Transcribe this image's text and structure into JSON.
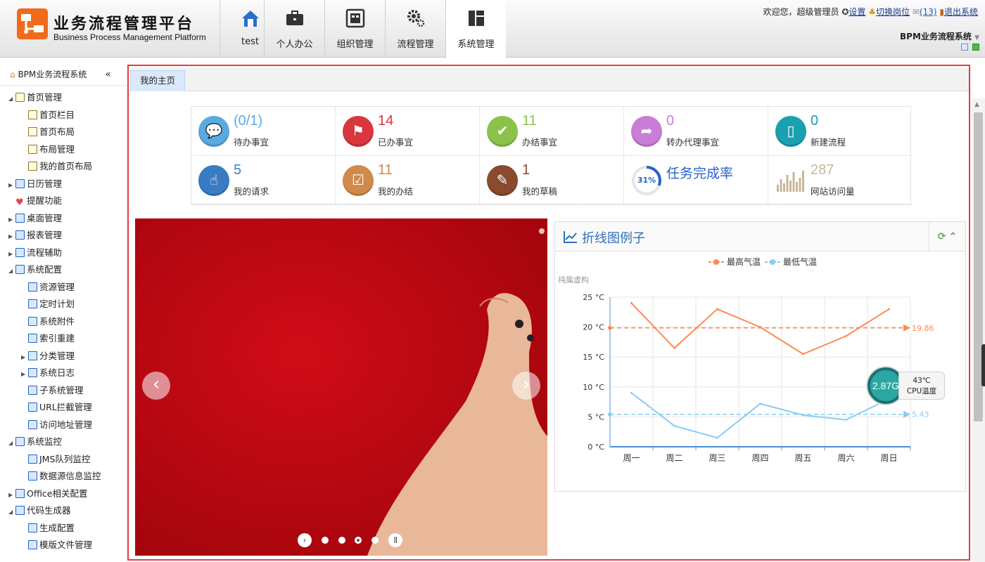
{
  "header": {
    "app_title": "业务流程管理平台",
    "app_subtitle": "Business Process Management Platform",
    "nav_tabs": [
      {
        "label": "test",
        "icon": "house-icon"
      },
      {
        "label": "个人办公",
        "icon": "briefcase-icon"
      },
      {
        "label": "组织管理",
        "icon": "org-chart-icon"
      },
      {
        "label": "流程管理",
        "icon": "gears-icon"
      },
      {
        "label": "系统管理",
        "icon": "dashboard-icon",
        "active": true
      }
    ],
    "welcome": "欢迎您，超级管理员",
    "settings_link": "设置",
    "switch_post_link": "切换岗位",
    "mail_count": "(13)",
    "logout_link": "退出系统",
    "system_select": "BPM业务流程系统"
  },
  "sidebar": {
    "title": "BPM业务流程系统",
    "collapse": "«",
    "items": [
      {
        "label": "首页管理",
        "level": 0,
        "expanded": true,
        "icon": "doc-icon"
      },
      {
        "label": "首页栏目",
        "level": 1,
        "icon": "doc-icon"
      },
      {
        "label": "首页布局",
        "level": 1,
        "icon": "doc-icon"
      },
      {
        "label": "布局管理",
        "level": 1,
        "icon": "doc-icon"
      },
      {
        "label": "我的首页布局",
        "level": 1,
        "icon": "doc-icon"
      },
      {
        "label": "日历管理",
        "level": 0,
        "expanded": false,
        "icon": "calendar-icon"
      },
      {
        "label": "提醒功能",
        "level": 0,
        "icon": "heart-icon"
      },
      {
        "label": "桌面管理",
        "level": 0,
        "expanded": false,
        "icon": "desktop-icon"
      },
      {
        "label": "报表管理",
        "level": 0,
        "expanded": false,
        "icon": "report-icon"
      },
      {
        "label": "流程辅助",
        "level": 0,
        "expanded": false,
        "icon": "flow-icon"
      },
      {
        "label": "系统配置",
        "level": 0,
        "expanded": true,
        "icon": "gear-icon"
      },
      {
        "label": "资源管理",
        "level": 1,
        "icon": "resource-icon"
      },
      {
        "label": "定时计划",
        "level": 1,
        "icon": "clock-icon"
      },
      {
        "label": "系统附件",
        "level": 1,
        "icon": "attachment-icon"
      },
      {
        "label": "索引重建",
        "level": 1,
        "icon": "index-icon"
      },
      {
        "label": "分类管理",
        "level": 1,
        "expanded": false,
        "icon": "bars-icon"
      },
      {
        "label": "系统日志",
        "level": 1,
        "expanded": false,
        "icon": "log-icon"
      },
      {
        "label": "子系统管理",
        "level": 1,
        "icon": "subsystem-icon"
      },
      {
        "label": "URL拦截管理",
        "level": 1,
        "icon": "url-icon"
      },
      {
        "label": "访问地址管理",
        "level": 1,
        "icon": "address-icon"
      },
      {
        "label": "系统监控",
        "level": 0,
        "expanded": true,
        "icon": "monitor-icon"
      },
      {
        "label": "JMS队列监控",
        "level": 1,
        "icon": "queue-icon"
      },
      {
        "label": "数据源信息监控",
        "level": 1,
        "icon": "datasource-icon"
      },
      {
        "label": "Office相关配置",
        "level": 0,
        "expanded": false,
        "icon": "office-icon"
      },
      {
        "label": "代码生成器",
        "level": 0,
        "expanded": true,
        "icon": "code-icon"
      },
      {
        "label": "生成配置",
        "level": 1,
        "icon": "gear-icon"
      },
      {
        "label": "模版文件管理",
        "level": 1,
        "icon": "file-icon"
      }
    ]
  },
  "main": {
    "tab_home": "我的主页",
    "stats": [
      {
        "value": "(0/1)",
        "label": "待办事宜",
        "color": "#5aa9e0",
        "icon": "chat-icon"
      },
      {
        "value": "14",
        "label": "已办事宜",
        "color": "#d9363e",
        "icon": "flag-icon"
      },
      {
        "value": "11",
        "label": "办结事宜",
        "color": "#8bc34a",
        "icon": "check-icon"
      },
      {
        "value": "0",
        "label": "转办代理事宜",
        "color": "#c97dd6",
        "icon": "forward-icon"
      },
      {
        "value": "0",
        "label": "新建流程",
        "color": "#1aa0b0",
        "icon": "document-icon"
      },
      {
        "value": "5",
        "label": "我的请求",
        "color": "#3a7cc4",
        "icon": "hand-icon"
      },
      {
        "value": "11",
        "label": "我的办结",
        "color": "#d08a4a",
        "icon": "checkbox-icon"
      },
      {
        "value": "1",
        "label": "我的草稿",
        "color": "#8a4a2e",
        "icon": "edit-icon"
      },
      {
        "value": "任务完成率",
        "label": "",
        "color": "#2a62c8",
        "icon": "progress-ring-icon",
        "percent_text": "31%",
        "percent": 31
      },
      {
        "value": "287",
        "label": "网站访问量",
        "color": "#c7b89a",
        "icon": "bar-chart-icon"
      }
    ],
    "carousel": {
      "prev": "‹",
      "next": "›",
      "dots": 4,
      "pause": "Ⅱ",
      "play": "›"
    },
    "chart_panel": {
      "title": "折线图例子",
      "refresh": "⟳",
      "collapse": "⌃"
    },
    "cpu": {
      "value": "2.87G",
      "temp": "43℃",
      "label": "CPU温度"
    }
  },
  "chart_data": {
    "type": "line",
    "title": "",
    "subtitle": "纯属虚构",
    "categories": [
      "周一",
      "周二",
      "周三",
      "周四",
      "周五",
      "周六",
      "周日"
    ],
    "series": [
      {
        "name": "最高气温",
        "values": [
          24,
          16.5,
          23,
          20,
          15.5,
          18.5,
          23
        ],
        "color": "#ff8a50",
        "avg": 19.86,
        "avg_label": "19.86"
      },
      {
        "name": "最低气温",
        "values": [
          9,
          3.5,
          1.5,
          7.2,
          5.3,
          4.5,
          8
        ],
        "color": "#87cef5",
        "avg": 5.43,
        "avg_label": "5.43"
      }
    ],
    "yticks": [
      "0 °C",
      "5 °C",
      "10 °C",
      "15 °C",
      "20 °C",
      "25 °C"
    ],
    "ylim": [
      0,
      25
    ],
    "legend": "top-center",
    "grid": true
  }
}
